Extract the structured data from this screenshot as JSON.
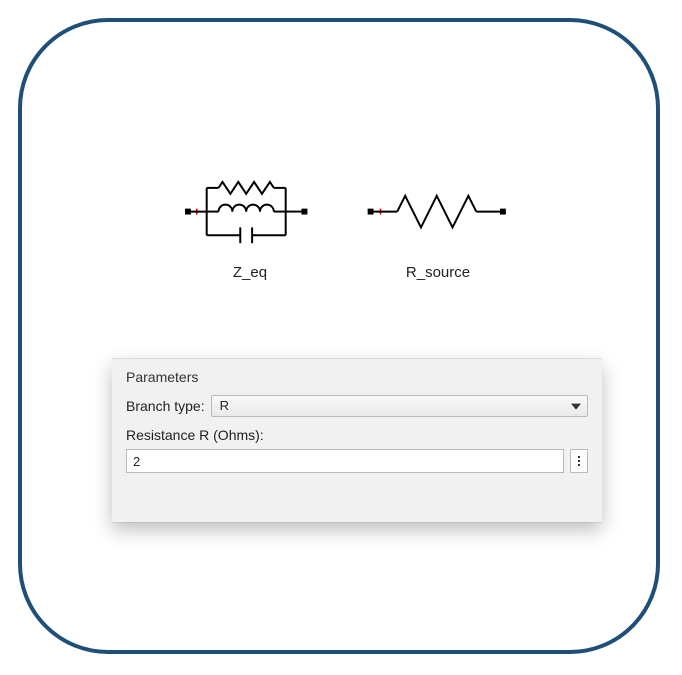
{
  "components": {
    "z_eq": {
      "label": "Z_eq"
    },
    "r_source": {
      "label": "R_source"
    }
  },
  "panel": {
    "title": "Parameters",
    "branch_type_label": "Branch type:",
    "branch_type_value": "R",
    "resistance_label": "Resistance R (Ohms):",
    "resistance_value": "2"
  }
}
